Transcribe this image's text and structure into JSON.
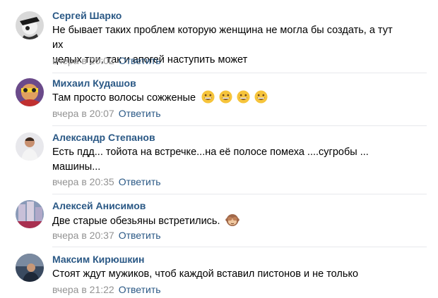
{
  "comments": [
    {
      "author": "Сергей Шарко",
      "text_line1": "Не бывает таких проблем которую женщина не могла бы создать, а тут их",
      "text_line2": "целых три, так и апогей наступить может",
      "time": "вчера в 20:02",
      "reply": "Ответить"
    },
    {
      "author": "Михаил Кудашов",
      "text": "Там просто волосы сожженые",
      "emoji": "grinning-face",
      "emoji_count": 4,
      "time": "вчера в 20:07",
      "reply": "Ответить"
    },
    {
      "author": "Александр Степанов",
      "text_line1": "Есть пдд... тойота на встречке...на её полосе помеха ....сугробы ...",
      "text_line2": "машины...",
      "time": "вчера в 20:35",
      "reply": "Ответить"
    },
    {
      "author": "Алексей Анисимов",
      "text": "Две старые обезьяны встретились.",
      "emoji": "see-no-evil-monkey",
      "time": "вчера в 20:37",
      "reply": "Ответить"
    },
    {
      "author": "Максим Кирюшкин",
      "text": "Стоят ждут мужиков, чтоб каждой вставил пистонов и не только",
      "time": "вчера в 21:22",
      "reply": "Ответить"
    }
  ],
  "colors": {
    "author": "#2a5885",
    "meta": "#939393",
    "divider": "#e7e8ec",
    "text": "#000000"
  }
}
